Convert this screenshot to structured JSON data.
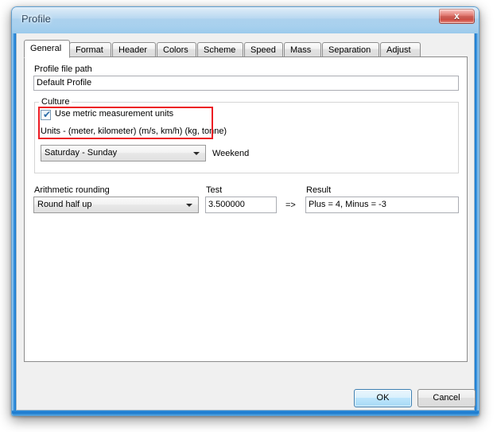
{
  "window": {
    "title": "Profile",
    "close_label": "x",
    "close_icon": "close-icon"
  },
  "tabs": [
    {
      "label": "General",
      "selected": true
    },
    {
      "label": "Format",
      "selected": false
    },
    {
      "label": "Header",
      "selected": false
    },
    {
      "label": "Colors",
      "selected": false
    },
    {
      "label": "Scheme",
      "selected": false
    },
    {
      "label": "Speed",
      "selected": false
    },
    {
      "label": "Mass",
      "selected": false
    },
    {
      "label": "Separation",
      "selected": false
    },
    {
      "label": "Adjust",
      "selected": false
    }
  ],
  "general": {
    "profile_path_label": "Profile file path",
    "profile_path_value": "Default Profile",
    "culture": {
      "group_title": "Culture",
      "metric_checkbox_label": "Use metric measurement units",
      "metric_checkbox_checked": true,
      "check_glyph": "✔",
      "units_text": "Units - (meter, kilometer) (m/s, km/h) (kg, tonne)",
      "weekend_value": "Saturday - Sunday",
      "weekend_label": "Weekend"
    },
    "rounding": {
      "rounding_label": "Arithmetic rounding",
      "rounding_value": "Round half up",
      "test_label": "Test",
      "test_value": "3.500000",
      "arrow": "=>",
      "result_label": "Result",
      "result_value": "Plus = 4, Minus = -3"
    }
  },
  "footer": {
    "ok_label": "OK",
    "cancel_label": "Cancel"
  },
  "colors": {
    "highlight": "#ec1c24",
    "accent": "#3c7fb1",
    "titlebar": "#9ecbec"
  }
}
